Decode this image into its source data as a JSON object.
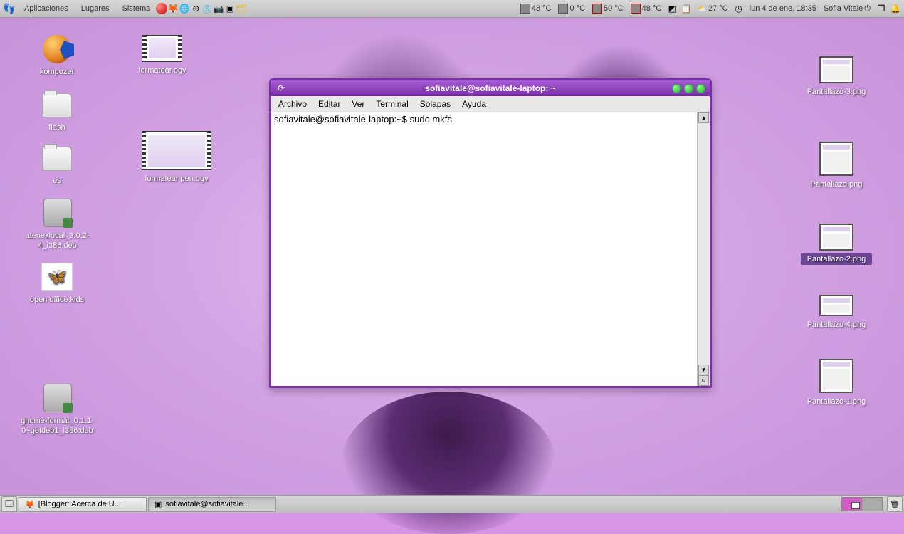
{
  "panel": {
    "menus": [
      "Aplicaciones",
      "Lugares",
      "Sistema"
    ],
    "temps": [
      "48 °C",
      "0 °C",
      "50 °C",
      "48 °C"
    ],
    "weather": "27 °C",
    "clock": "lun  4 de ene, 18:35",
    "user": "Sofia Vitale"
  },
  "desktop_icons_left": [
    {
      "name": "kompozer",
      "label": "kompozer",
      "type": "globe"
    },
    {
      "name": "flash",
      "label": "flash",
      "type": "folder"
    },
    {
      "name": "es",
      "label": "es",
      "type": "folder"
    },
    {
      "name": "atenex",
      "label": "atenexlocal_3.0.2-4_i386.deb",
      "type": "deb"
    },
    {
      "name": "openofficekids",
      "label": "open office kids",
      "type": "butterfly"
    },
    {
      "name": "gnome-format",
      "label": "gnome-format_0.1.1-0~getdeb1_i386.deb",
      "type": "deb"
    }
  ],
  "desktop_icons_mid": [
    {
      "name": "formatear-ogv",
      "label": "formatear.ogv",
      "type": "video"
    },
    {
      "name": "formatear-pen",
      "label": "formatear pen.ogv",
      "type": "video"
    }
  ],
  "desktop_icons_right": [
    {
      "name": "pantallazo3",
      "label": "Pantallazo-3.png"
    },
    {
      "name": "pantallazo",
      "label": "Pantallazo.png"
    },
    {
      "name": "pantallazo2",
      "label": "Pantallazo-2.png"
    },
    {
      "name": "pantallazo4",
      "label": "Pantallazo-4.png"
    },
    {
      "name": "pantallazo1",
      "label": "Pantallazo-1.png"
    }
  ],
  "terminal": {
    "title": "sofiavitale@sofiavitale-laptop: ~",
    "menus": [
      "Archivo",
      "Editar",
      "Ver",
      "Terminal",
      "Solapas",
      "Ayuda"
    ],
    "prompt": "sofiavitale@sofiavitale-laptop:~$ ",
    "command": "sudo mkfs."
  },
  "taskbar": {
    "items": [
      {
        "name": "blogger",
        "label": "[Blogger: Acerca de U..."
      },
      {
        "name": "terminal",
        "label": "sofiavitale@sofiavitale...",
        "active": true
      }
    ]
  }
}
